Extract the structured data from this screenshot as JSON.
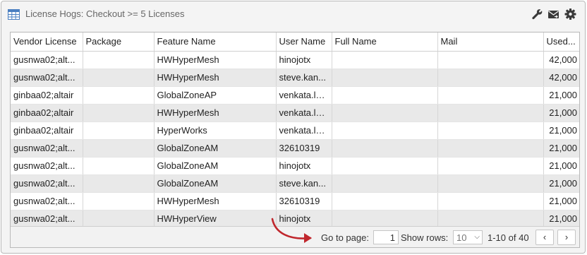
{
  "panel": {
    "title": "License Hogs: Checkout >= 5 Licenses",
    "icons": [
      "table-icon",
      "wrench-icon",
      "mail-icon",
      "gear-icon"
    ]
  },
  "table": {
    "columns": [
      "Vendor License",
      "Package",
      "Feature Name",
      "User Name",
      "Full Name",
      "Mail",
      "Used..."
    ],
    "rows": [
      [
        "gusnwa02;alt...",
        "",
        "HWHyperMesh",
        "hinojotx",
        "",
        "",
        "42,000"
      ],
      [
        "gusnwa02;alt...",
        "",
        "HWHyperMesh",
        "steve.kan...",
        "",
        "",
        "42,000"
      ],
      [
        "ginbaa02;altair",
        "",
        "GlobalZoneAP",
        "venkata.la...",
        "",
        "",
        "21,000"
      ],
      [
        "ginbaa02;altair",
        "",
        "HWHyperMesh",
        "venkata.la...",
        "",
        "",
        "21,000"
      ],
      [
        "ginbaa02;altair",
        "",
        "HyperWorks",
        "venkata.la...",
        "",
        "",
        "21,000"
      ],
      [
        "gusnwa02;alt...",
        "",
        "GlobalZoneAM",
        "32610319",
        "",
        "",
        "21,000"
      ],
      [
        "gusnwa02;alt...",
        "",
        "GlobalZoneAM",
        "hinojotx",
        "",
        "",
        "21,000"
      ],
      [
        "gusnwa02;alt...",
        "",
        "GlobalZoneAM",
        "steve.kan...",
        "",
        "",
        "21,000"
      ],
      [
        "gusnwa02;alt...",
        "",
        "HWHyperMesh",
        "32610319",
        "",
        "",
        "21,000"
      ],
      [
        "gusnwa02;alt...",
        "",
        "HWHyperView",
        "hinojotx",
        "",
        "",
        "21,000"
      ]
    ]
  },
  "pager": {
    "goto_label": "Go to page:",
    "page_value": "1",
    "show_rows_label": "Show rows:",
    "rows_value": "10",
    "range_text": "1-10 of 40",
    "prev_glyph": "‹",
    "next_glyph": "›"
  },
  "colors": {
    "accent_icon": "#4a7fc1",
    "annotation_arrow": "#c0272d",
    "row_stripe": "#e9e9e9"
  }
}
